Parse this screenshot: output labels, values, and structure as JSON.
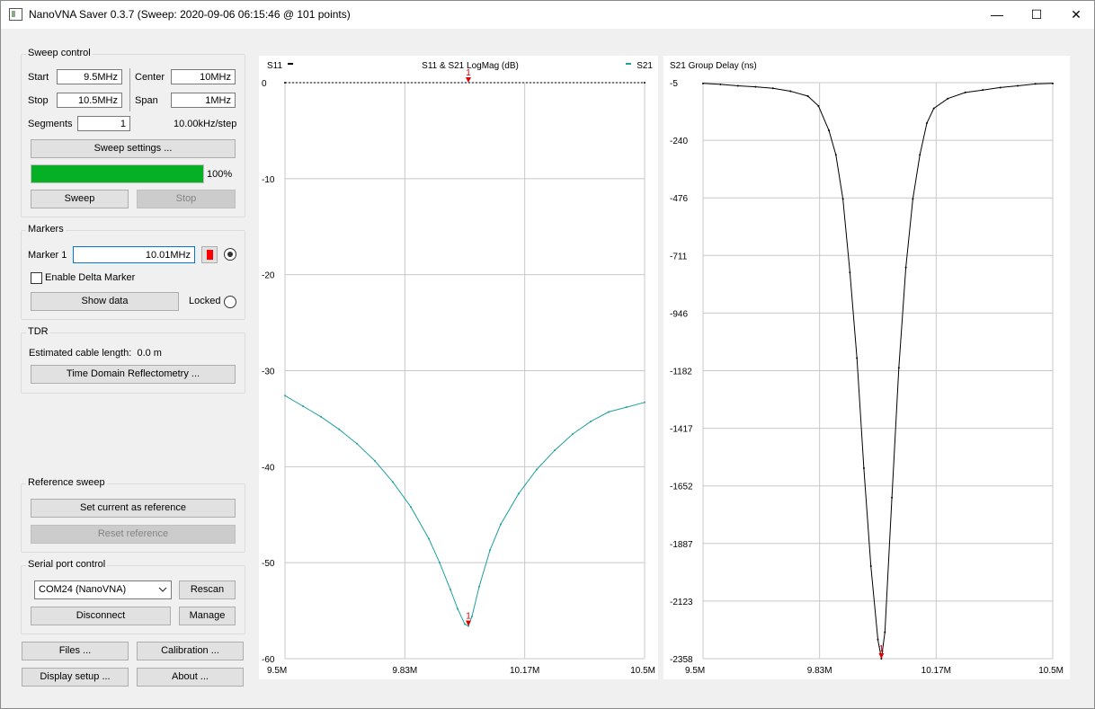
{
  "window": {
    "title": "NanoVNA Saver 0.3.7 (Sweep: 2020-09-06 06:15:46 @ 101 points)",
    "minimize": "—",
    "maximize": "☐",
    "close": "✕"
  },
  "sweep": {
    "group_title": "Sweep control",
    "start_label": "Start",
    "start_value": "9.5MHz",
    "center_label": "Center",
    "center_value": "10MHz",
    "stop_label": "Stop",
    "stop_value": "10.5MHz",
    "span_label": "Span",
    "span_value": "1MHz",
    "segments_label": "Segments",
    "segments_value": "1",
    "step_text": "10.00kHz/step",
    "settings_button": "Sweep settings ...",
    "progress": 100,
    "progress_text": "100%",
    "sweep_button": "Sweep",
    "stop_button": "Stop"
  },
  "markers": {
    "group_title": "Markers",
    "marker1_label": "Marker 1",
    "marker1_value": "10.01MHz",
    "marker1_color": "#ff0000",
    "delta_label": "Enable Delta Marker",
    "show_data_button": "Show data",
    "locked_label": "Locked"
  },
  "tdr": {
    "group_title": "TDR",
    "cable_text": "Estimated cable length:  0.0 m",
    "tdr_button": "Time Domain Reflectometry ..."
  },
  "reference": {
    "group_title": "Reference sweep",
    "set_button": "Set current as reference",
    "reset_button": "Reset reference"
  },
  "serial": {
    "group_title": "Serial port control",
    "port_value": "COM24 (NanoVNA)",
    "rescan_button": "Rescan",
    "disconnect_button": "Disconnect",
    "manage_button": "Manage"
  },
  "bottom_buttons": {
    "files": "Files ...",
    "calibration": "Calibration ...",
    "display_setup": "Display setup ...",
    "about": "About ..."
  },
  "chart_data": [
    {
      "type": "line",
      "title": "S11 & S21 LogMag (dB)",
      "ylim": [
        -60,
        0
      ],
      "yticks": [
        "0",
        "-10",
        "-20",
        "-30",
        "-40",
        "-50",
        "-60"
      ],
      "xticks": [
        "9.5M",
        "9.83M",
        "10.17M",
        "10.5M"
      ],
      "xlim": [
        9.5,
        10.5
      ],
      "legend_left": "S11",
      "legend_right": "S21",
      "series": [
        {
          "name": "S11",
          "color": "#000000",
          "x": [
            9.5,
            10.5
          ],
          "values": [
            0,
            0
          ]
        },
        {
          "name": "S21",
          "color": "#20a0a0",
          "x": [
            9.5,
            9.55,
            9.6,
            9.65,
            9.7,
            9.75,
            9.8,
            9.85,
            9.9,
            9.93,
            9.96,
            9.98,
            10.0,
            10.01,
            10.02,
            10.04,
            10.07,
            10.1,
            10.15,
            10.2,
            10.25,
            10.3,
            10.35,
            10.4,
            10.45,
            10.5
          ],
          "values": [
            -32.6,
            -33.7,
            -34.8,
            -36.1,
            -37.6,
            -39.4,
            -41.6,
            -44.2,
            -47.5,
            -50.0,
            -52.8,
            -54.8,
            -56.4,
            -56.6,
            -55.6,
            -52.5,
            -48.7,
            -46.0,
            -42.8,
            -40.3,
            -38.3,
            -36.6,
            -35.3,
            -34.3,
            -33.8,
            -33.3
          ]
        }
      ],
      "marker": {
        "label": "1",
        "x": 10.01
      }
    },
    {
      "type": "line",
      "title": "S21 Group Delay (ns)",
      "ylim": [
        -2358,
        -5
      ],
      "yticks": [
        "-5",
        "-240",
        "-476",
        "-711",
        "-946",
        "-1182",
        "-1417",
        "-1652",
        "-1887",
        "-2123",
        "-2358"
      ],
      "xticks": [
        "9.5M",
        "9.83M",
        "10.17M",
        "10.5M"
      ],
      "xlim": [
        9.5,
        10.5
      ],
      "series": [
        {
          "name": "S21",
          "color": "#000000",
          "x": [
            9.5,
            9.55,
            9.6,
            9.65,
            9.7,
            9.75,
            9.8,
            9.83,
            9.86,
            9.88,
            9.9,
            9.92,
            9.94,
            9.96,
            9.98,
            10.0,
            10.01,
            10.02,
            10.04,
            10.06,
            10.08,
            10.1,
            10.12,
            10.14,
            10.16,
            10.2,
            10.25,
            10.3,
            10.35,
            10.4,
            10.45,
            10.5
          ],
          "values": [
            -8,
            -12,
            -18,
            -22,
            -28,
            -40,
            -60,
            -100,
            -200,
            -300,
            -480,
            -780,
            -1130,
            -1580,
            -1980,
            -2280,
            -2358,
            -2250,
            -1700,
            -1170,
            -760,
            -480,
            -300,
            -170,
            -110,
            -70,
            -45,
            -35,
            -25,
            -18,
            -10,
            -8
          ]
        }
      ],
      "marker": {
        "label": "1",
        "x": 10.01
      }
    }
  ]
}
